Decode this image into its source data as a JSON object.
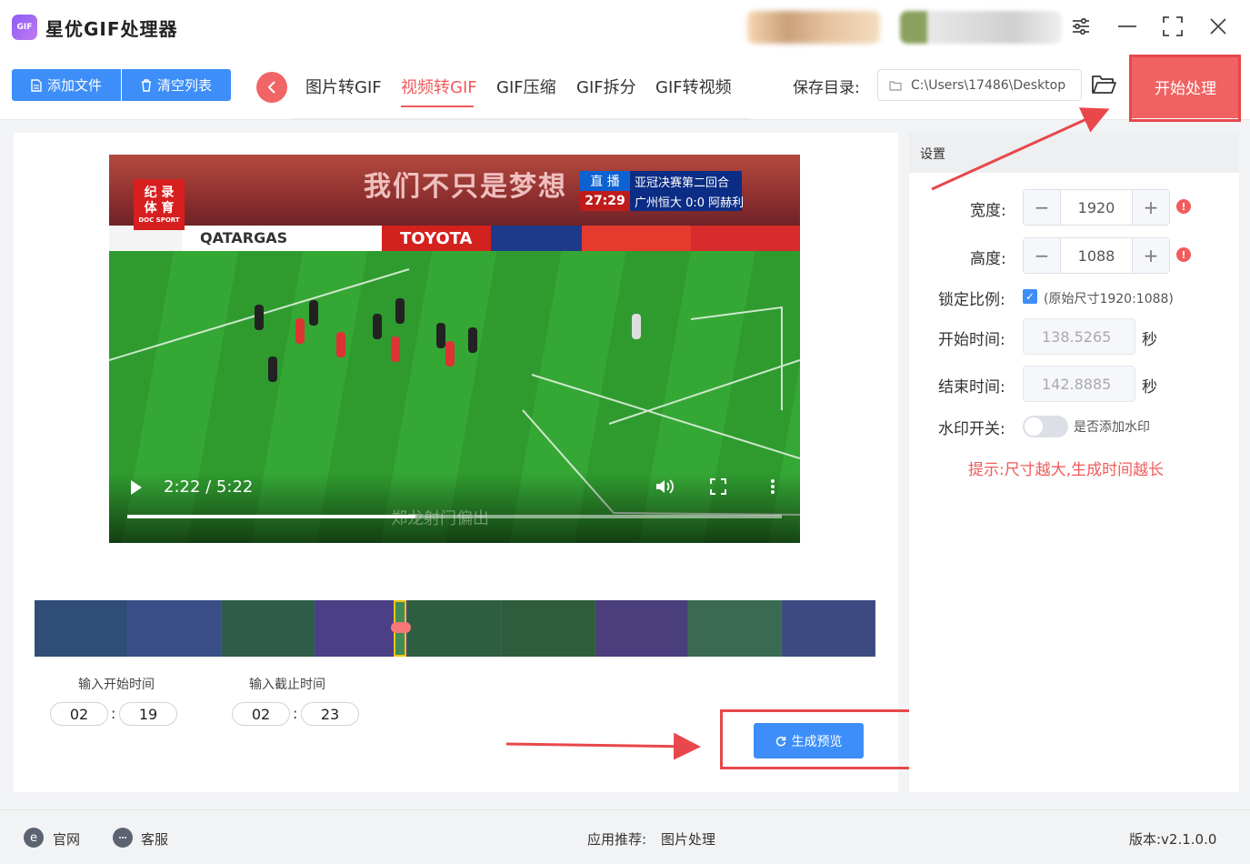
{
  "app": {
    "title": "星优GIF处理器",
    "logo_text": "GIF"
  },
  "toolbar": {
    "add_file": "添加文件",
    "clear_list": "清空列表",
    "back_icon": "chevron-left-icon",
    "tabs": [
      "图片转GIF",
      "视频转GIF",
      "GIF压缩",
      "GIF拆分",
      "GIF转视频"
    ],
    "active_tab": "视频转GIF",
    "save_dir_label": "保存目录:",
    "save_dir_path": "C:\\Users\\17486\\Desktop",
    "start_button": "开始处理"
  },
  "video": {
    "logo_lines": [
      "纪 录",
      "体 育",
      "DOC SPORT"
    ],
    "banner": "我们不只是梦想",
    "live_tag": "直 播",
    "live_time": "27:29",
    "live_title": "亚冠决赛第二回合",
    "live_score": "广州恒大 0:0 阿赫利",
    "sponsor_1": "QATARGAS",
    "sponsor_2": "TOYOTA",
    "subtitle": "郑龙射门偏出",
    "current_time": "2:22",
    "duration": "5:22",
    "time_display": "2:22 / 5:22",
    "progress": 0.44
  },
  "trim": {
    "start_label": "输入开始时间",
    "end_label": "输入截止时间",
    "start_min": "02",
    "start_sec": "19",
    "end_min": "02",
    "end_sec": "23",
    "preview_button": "生成预览"
  },
  "settings": {
    "header": "设置",
    "width_label": "宽度:",
    "width_value": "1920",
    "height_label": "高度:",
    "height_value": "1088",
    "lock_label": "锁定比例:",
    "lock_checked": true,
    "lock_text": "(原始尺寸1920:1088)",
    "start_label": "开始时间:",
    "start_value": "138.5265",
    "end_label": "结束时间:",
    "end_value": "142.8885",
    "sec_unit": "秒",
    "watermark_label": "水印开关:",
    "watermark_text": "是否添加水印",
    "watermark_on": false,
    "tip": "提示:尺寸越大,生成时间越长"
  },
  "statusbar": {
    "website": "官网",
    "support": "客服",
    "recommend_label": "应用推荐:",
    "recommend_app": "图片处理",
    "version": "版本:v2.1.0.0"
  },
  "colors": {
    "accent_blue": "#3d8ef8",
    "accent_red": "#f05b5b",
    "annotation_red": "#e8474b"
  }
}
